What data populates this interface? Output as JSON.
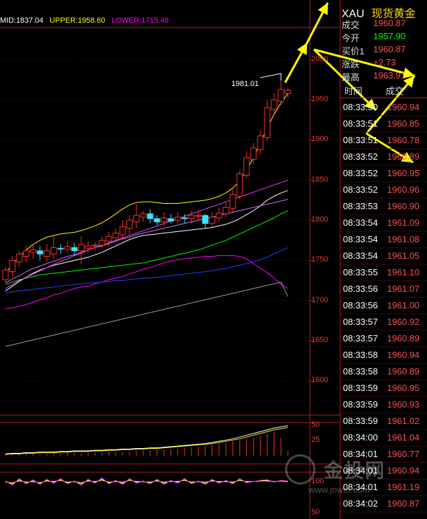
{
  "legend": {
    "mid": "MID:1837.04",
    "upper": "UPPER:1958.60",
    "lower": "LOWER:1715.48",
    "colors": {
      "mid": "#ffffff",
      "upper": "#ffff00",
      "lower": "#ff00ff"
    }
  },
  "header": {
    "symbol": "XAU",
    "name": "现货黄金"
  },
  "quote": [
    {
      "label": "成交",
      "value": "1960.87",
      "color": "#ff5050"
    },
    {
      "label": "今开",
      "value": "1957.90",
      "color": "#00ff00"
    },
    {
      "label": "买价1",
      "value": "1960.87",
      "color": "#ff5050"
    },
    {
      "label": "涨跌",
      "value": "+2.73",
      "color": "#ff5050"
    },
    {
      "label": "最高",
      "value": "1963.91",
      "color": "#ff5050"
    }
  ],
  "ticks_header": {
    "time": "时间",
    "price": "成交"
  },
  "ticks": [
    {
      "time": "08:33:50",
      "price": "1960.94"
    },
    {
      "time": "08:33:51",
      "price": "1960.85"
    },
    {
      "time": "08:33:51",
      "price": "1960.78"
    },
    {
      "time": "08:33:52",
      "price": "1960.89"
    },
    {
      "time": "08:33:52",
      "price": "1960.95"
    },
    {
      "time": "08:33:52",
      "price": "1960.96"
    },
    {
      "time": "08:33:53",
      "price": "1960.90"
    },
    {
      "time": "08:33:54",
      "price": "1961.09"
    },
    {
      "time": "08:33:54",
      "price": "1961.08"
    },
    {
      "time": "08:33:54",
      "price": "1961.05"
    },
    {
      "time": "08:33:55",
      "price": "1961.10"
    },
    {
      "time": "08:33:56",
      "price": "1961.07"
    },
    {
      "time": "08:33:56",
      "price": "1961.00"
    },
    {
      "time": "08:33:57",
      "price": "1960.92"
    },
    {
      "time": "08:33:57",
      "price": "1960.89"
    },
    {
      "time": "08:33:58",
      "price": "1960.94"
    },
    {
      "time": "08:33:58",
      "price": "1960.89"
    },
    {
      "time": "08:33:59",
      "price": "1960.95"
    },
    {
      "time": "08:33:59",
      "price": "1960.93"
    },
    {
      "time": "08:33:59",
      "price": "1961.02"
    },
    {
      "time": "08:34:00",
      "price": "1961.04"
    },
    {
      "time": "08:34:01",
      "price": "1960.77"
    },
    {
      "time": "08:34:01",
      "price": "1960.94"
    },
    {
      "time": "08:34:01",
      "price": "1961.19"
    },
    {
      "time": "08:34:02",
      "price": "1960.87"
    }
  ],
  "watermark": {
    "text": "金投网",
    "url": "www.jnwei.com"
  },
  "chart_data": [
    {
      "type": "candlestick",
      "ylim": [
        1560,
        2040
      ],
      "y_ticks": [
        "2000",
        "1950",
        "1900",
        "1850",
        "1800",
        "1750",
        "1700",
        "1650",
        "1600"
      ],
      "annotation": "1981.01",
      "candles": [
        [
          1726,
          1738,
          1722,
          1742
        ],
        [
          1736,
          1750,
          1730,
          1755
        ],
        [
          1748,
          1758,
          1742,
          1762
        ],
        [
          1755,
          1762,
          1748,
          1768
        ],
        [
          1760,
          1763,
          1752,
          1770
        ],
        [
          1762,
          1758,
          1750,
          1768
        ],
        [
          1755,
          1762,
          1748,
          1770
        ],
        [
          1758,
          1766,
          1752,
          1780
        ],
        [
          1765,
          1764,
          1758,
          1770
        ],
        [
          1764,
          1767,
          1760,
          1774
        ],
        [
          1766,
          1762,
          1756,
          1772
        ],
        [
          1762,
          1770,
          1745,
          1780
        ],
        [
          1765,
          1768,
          1760,
          1774
        ],
        [
          1768,
          1769,
          1762,
          1772
        ],
        [
          1769,
          1775,
          1765,
          1780
        ],
        [
          1774,
          1780,
          1768,
          1786
        ],
        [
          1778,
          1784,
          1772,
          1790
        ],
        [
          1782,
          1792,
          1776,
          1800
        ],
        [
          1790,
          1800,
          1782,
          1806
        ],
        [
          1798,
          1806,
          1790,
          1820
        ],
        [
          1804,
          1808,
          1798,
          1812
        ],
        [
          1808,
          1802,
          1796,
          1814
        ],
        [
          1802,
          1798,
          1794,
          1806
        ],
        [
          1798,
          1803,
          1793,
          1810
        ],
        [
          1802,
          1799,
          1796,
          1808
        ],
        [
          1800,
          1804,
          1796,
          1810
        ],
        [
          1803,
          1802,
          1796,
          1808
        ],
        [
          1802,
          1806,
          1796,
          1812
        ],
        [
          1805,
          1806,
          1800,
          1812
        ],
        [
          1806,
          1796,
          1790,
          1808
        ],
        [
          1796,
          1804,
          1792,
          1810
        ],
        [
          1803,
          1809,
          1798,
          1816
        ],
        [
          1808,
          1816,
          1804,
          1822
        ],
        [
          1815,
          1832,
          1810,
          1838
        ],
        [
          1830,
          1858,
          1826,
          1862
        ],
        [
          1856,
          1878,
          1852,
          1886
        ],
        [
          1876,
          1890,
          1870,
          1896
        ],
        [
          1888,
          1905,
          1882,
          1912
        ],
        [
          1903,
          1940,
          1898,
          1950
        ],
        [
          1938,
          1950,
          1932,
          1958
        ],
        [
          1948,
          1963,
          1944,
          1981
        ],
        [
          1958,
          1962,
          1952,
          1964
        ]
      ],
      "series": [
        {
          "name": "UPPER",
          "color": "#ffff00",
          "values": [
            1734,
            1745,
            1755,
            1763,
            1770,
            1775,
            1779,
            1781,
            1783,
            1784,
            1785,
            1787,
            1790,
            1793,
            1797,
            1802,
            1808,
            1814,
            1819,
            1822,
            1823,
            1823,
            1822,
            1821,
            1821,
            1821,
            1822,
            1823,
            1824,
            1825,
            1827,
            1830,
            1834,
            1840,
            1849,
            1862,
            1878,
            1896,
            1915,
            1932,
            1946,
            1958
          ]
        },
        {
          "name": "MID",
          "color": "#ffffff",
          "values": [
            1712,
            1718,
            1724,
            1729,
            1734,
            1738,
            1741,
            1744,
            1746,
            1748,
            1750,
            1752,
            1754,
            1757,
            1760,
            1764,
            1768,
            1772,
            1776,
            1779,
            1781,
            1782,
            1783,
            1784,
            1785,
            1786,
            1787,
            1788,
            1789,
            1790,
            1791,
            1793,
            1795,
            1798,
            1802,
            1807,
            1812,
            1818,
            1825,
            1830,
            1834,
            1837
          ]
        },
        {
          "name": "LOWER",
          "color": "#ff00ff",
          "values": [
            1690,
            1691,
            1693,
            1695,
            1698,
            1701,
            1703,
            1707,
            1709,
            1712,
            1715,
            1717,
            1718,
            1721,
            1723,
            1726,
            1728,
            1730,
            1733,
            1736,
            1739,
            1741,
            1744,
            1747,
            1749,
            1751,
            1752,
            1753,
            1754,
            1755,
            1755,
            1756,
            1756,
            1756,
            1755,
            1752,
            1746,
            1740,
            1735,
            1728,
            1720,
            1715
          ]
        },
        {
          "name": "MA-green",
          "color": "#00ff00",
          "values": [
            1720,
            1723,
            1726,
            1728,
            1730,
            1732,
            1733,
            1734,
            1735,
            1736,
            1737,
            1738,
            1739,
            1740,
            1741,
            1742,
            1743,
            1744,
            1745,
            1746,
            1747,
            1749,
            1751,
            1753,
            1755,
            1757,
            1759,
            1761,
            1763,
            1766,
            1769,
            1772,
            1775,
            1779,
            1783,
            1787,
            1791,
            1795,
            1799,
            1803,
            1808,
            1812
          ]
        },
        {
          "name": "MA-blue",
          "color": "#2040ff",
          "values": [
            1710,
            1711,
            1712,
            1713,
            1714,
            1715,
            1716,
            1717,
            1718,
            1719,
            1720,
            1721,
            1722,
            1722,
            1723,
            1724,
            1725,
            1725,
            1726,
            1727,
            1728,
            1728,
            1729,
            1730,
            1731,
            1732,
            1733,
            1734,
            1735,
            1736,
            1737,
            1739,
            1740,
            1742,
            1744,
            1746,
            1748,
            1751,
            1754,
            1758,
            1762,
            1766
          ]
        },
        {
          "name": "MA-violet",
          "color": "#d070ff",
          "values": [
            1722,
            1727,
            1731,
            1736,
            1740,
            1743,
            1746,
            1749,
            1752,
            1755,
            1757,
            1760,
            1763,
            1766,
            1768,
            1771,
            1774,
            1777,
            1779,
            1782,
            1784,
            1786,
            1788,
            1790,
            1792,
            1794,
            1796,
            1798,
            1800,
            1802,
            1804,
            1806,
            1808,
            1810,
            1812,
            1814,
            1816,
            1818,
            1820,
            1822,
            1824,
            1826
          ]
        },
        {
          "name": "MA-magenta2",
          "color": "#ff40ff",
          "values": [
            1715,
            1720,
            1725,
            1729,
            1733,
            1737,
            1741,
            1745,
            1749,
            1752,
            1756,
            1759,
            1763,
            1766,
            1769,
            1772,
            1775,
            1778,
            1781,
            1784,
            1787,
            1790,
            1793,
            1796,
            1799,
            1802,
            1805,
            1808,
            1811,
            1814,
            1817,
            1820,
            1823,
            1826,
            1829,
            1832,
            1835,
            1838,
            1841,
            1844,
            1847,
            1850
          ]
        },
        {
          "name": "MA-gray",
          "color": "#9a9a9a",
          "values": [
            1643,
            1645,
            1647,
            1649,
            1651,
            1653,
            1655,
            1657,
            1659,
            1661,
            1663,
            1665,
            1667,
            1669,
            1671,
            1673,
            1675,
            1677,
            1679,
            1681,
            1683,
            1685,
            1687,
            1689,
            1691,
            1693,
            1695,
            1697,
            1699,
            1701,
            1703,
            1705,
            1707,
            1709,
            1711,
            1713,
            1715,
            1717,
            1719,
            1721,
            1723,
            1705
          ]
        }
      ]
    },
    {
      "type": "bar",
      "ylim": [
        0,
        55
      ],
      "y_ticks": [
        "50",
        "25"
      ],
      "values": [
        3,
        4,
        3,
        4,
        5,
        4,
        3,
        5,
        4,
        6,
        5,
        4,
        5,
        6,
        5,
        7,
        6,
        6,
        7,
        8,
        9,
        8,
        9,
        10,
        11,
        12,
        13,
        14,
        15,
        16,
        18,
        20,
        22,
        24,
        26,
        28,
        30,
        33,
        37,
        40,
        30,
        8
      ],
      "series": [
        {
          "name": "A",
          "color": "#ffffff",
          "values": [
            3,
            4,
            4,
            5,
            5,
            6,
            6,
            6,
            7,
            7,
            8,
            8,
            8,
            9,
            9,
            10,
            10,
            11,
            11,
            12,
            12,
            13,
            13,
            14,
            15,
            16,
            17,
            18,
            19,
            20,
            22,
            24,
            26,
            28,
            31,
            34,
            37,
            40,
            43,
            46,
            48,
            50
          ]
        },
        {
          "name": "B",
          "color": "#ffff00",
          "values": [
            2,
            3,
            3,
            4,
            4,
            5,
            5,
            5,
            6,
            6,
            7,
            7,
            7,
            8,
            8,
            9,
            9,
            10,
            10,
            11,
            11,
            12,
            12,
            13,
            14,
            15,
            16,
            17,
            18,
            19,
            20,
            22,
            24,
            26,
            28,
            31,
            34,
            37,
            40,
            43,
            45,
            47
          ]
        }
      ]
    },
    {
      "type": "line",
      "y_ticks": [
        "100",
        "50"
      ],
      "series": [
        {
          "name": "K",
          "color": "#ffffff",
          "values": [
            100,
            96,
            103,
            98,
            101,
            97,
            102,
            99,
            103,
            98,
            100,
            96,
            102,
            99,
            104,
            98,
            101,
            97,
            103,
            99,
            100,
            98,
            102,
            97,
            101,
            99,
            103,
            98,
            100,
            97,
            102,
            99,
            101,
            98,
            103,
            99,
            100,
            101,
            102,
            100,
            101,
            100
          ]
        },
        {
          "name": "D",
          "color": "#ffff00",
          "values": [
            99,
            98,
            101,
            99,
            100,
            98,
            101,
            100,
            102,
            99,
            100,
            98,
            101,
            100,
            102,
            99,
            100,
            99,
            102,
            100,
            100,
            99,
            101,
            99,
            100,
            100,
            102,
            99,
            100,
            99,
            101,
            100,
            100,
            99,
            102,
            100,
            100,
            101,
            101,
            100,
            101,
            100
          ]
        },
        {
          "name": "J",
          "color": "#ff00ff",
          "values": [
            101,
            94,
            105,
            96,
            103,
            95,
            104,
            97,
            105,
            96,
            101,
            94,
            104,
            97,
            106,
            96,
            102,
            95,
            105,
            97,
            101,
            96,
            104,
            95,
            102,
            97,
            105,
            96,
            101,
            95,
            104,
            97,
            102,
            96,
            105,
            98,
            100,
            102,
            103,
            99,
            102,
            101
          ]
        }
      ]
    }
  ]
}
